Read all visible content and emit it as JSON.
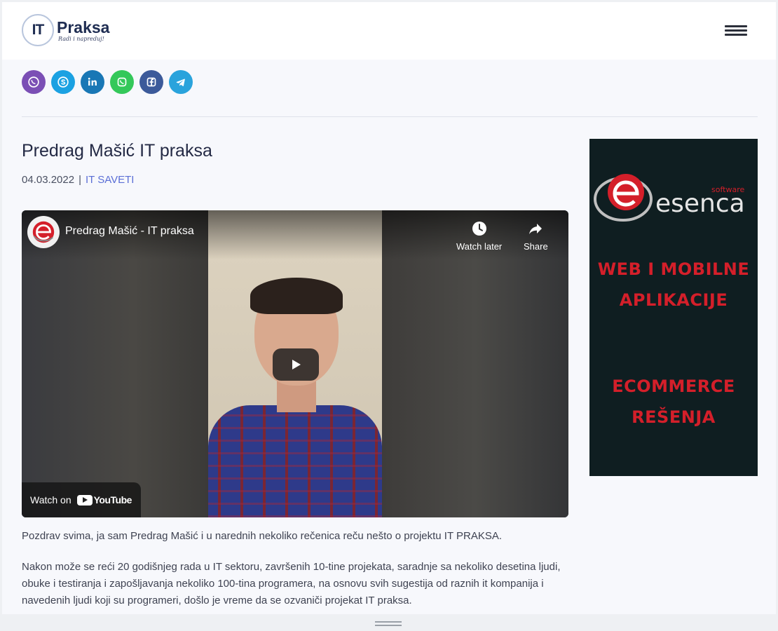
{
  "site": {
    "logo_mark": "IT",
    "logo_name": "Praksa",
    "logo_tagline": "Radi i napreduj!"
  },
  "header": {
    "menu_icon": "hamburger-menu-icon"
  },
  "share": [
    {
      "name": "viber",
      "icon": "viber-icon",
      "color": "#7b4fb5"
    },
    {
      "name": "skype",
      "icon": "skype-icon",
      "color": "#1ba1e2"
    },
    {
      "name": "linkedin",
      "icon": "linkedin-icon",
      "color": "#1977b5"
    },
    {
      "name": "whatsapp",
      "icon": "whatsapp-icon",
      "color": "#34c85a"
    },
    {
      "name": "facebook",
      "icon": "facebook-icon",
      "color": "#3c5a9a"
    },
    {
      "name": "telegram",
      "icon": "telegram-icon",
      "color": "#2aa3dc"
    }
  ],
  "article": {
    "title": "Predrag Mašić IT praksa",
    "date": "04.03.2022",
    "separator": "|",
    "category": "IT SAVETI",
    "paragraphs": [
      "Pozdrav svima, ja sam Predrag Mašić i u narednih nekoliko rečenica reču nešto o projektu IT PRAKSA.",
      "Nakon može se reći 20 godišnjeg rada u IT sektoru, završenih 10-tine projekata, saradnje sa nekoliko desetina ljudi, obuke i testiranja i zapošljavanja nekoliko 100-tina programera, na osnovu svih sugestija od raznih it kompanija i navedenih ljudi koji su programeri, došlo je vreme da se ozvaniči projekat IT praksa."
    ]
  },
  "video": {
    "title": "Predrag Mašić - IT praksa",
    "watch_later": "Watch later",
    "share": "Share",
    "watch_on": "Watch on",
    "youtube": "YouTube"
  },
  "ad": {
    "brand": "esenca",
    "brand_sub": "software",
    "line1": "WEB I MOBILNE",
    "line2": "APLIKACIJE",
    "line3": "ECOMMERCE",
    "line4": "REŠENJA",
    "accent": "#d41f2a",
    "background": "#0f1e21"
  }
}
